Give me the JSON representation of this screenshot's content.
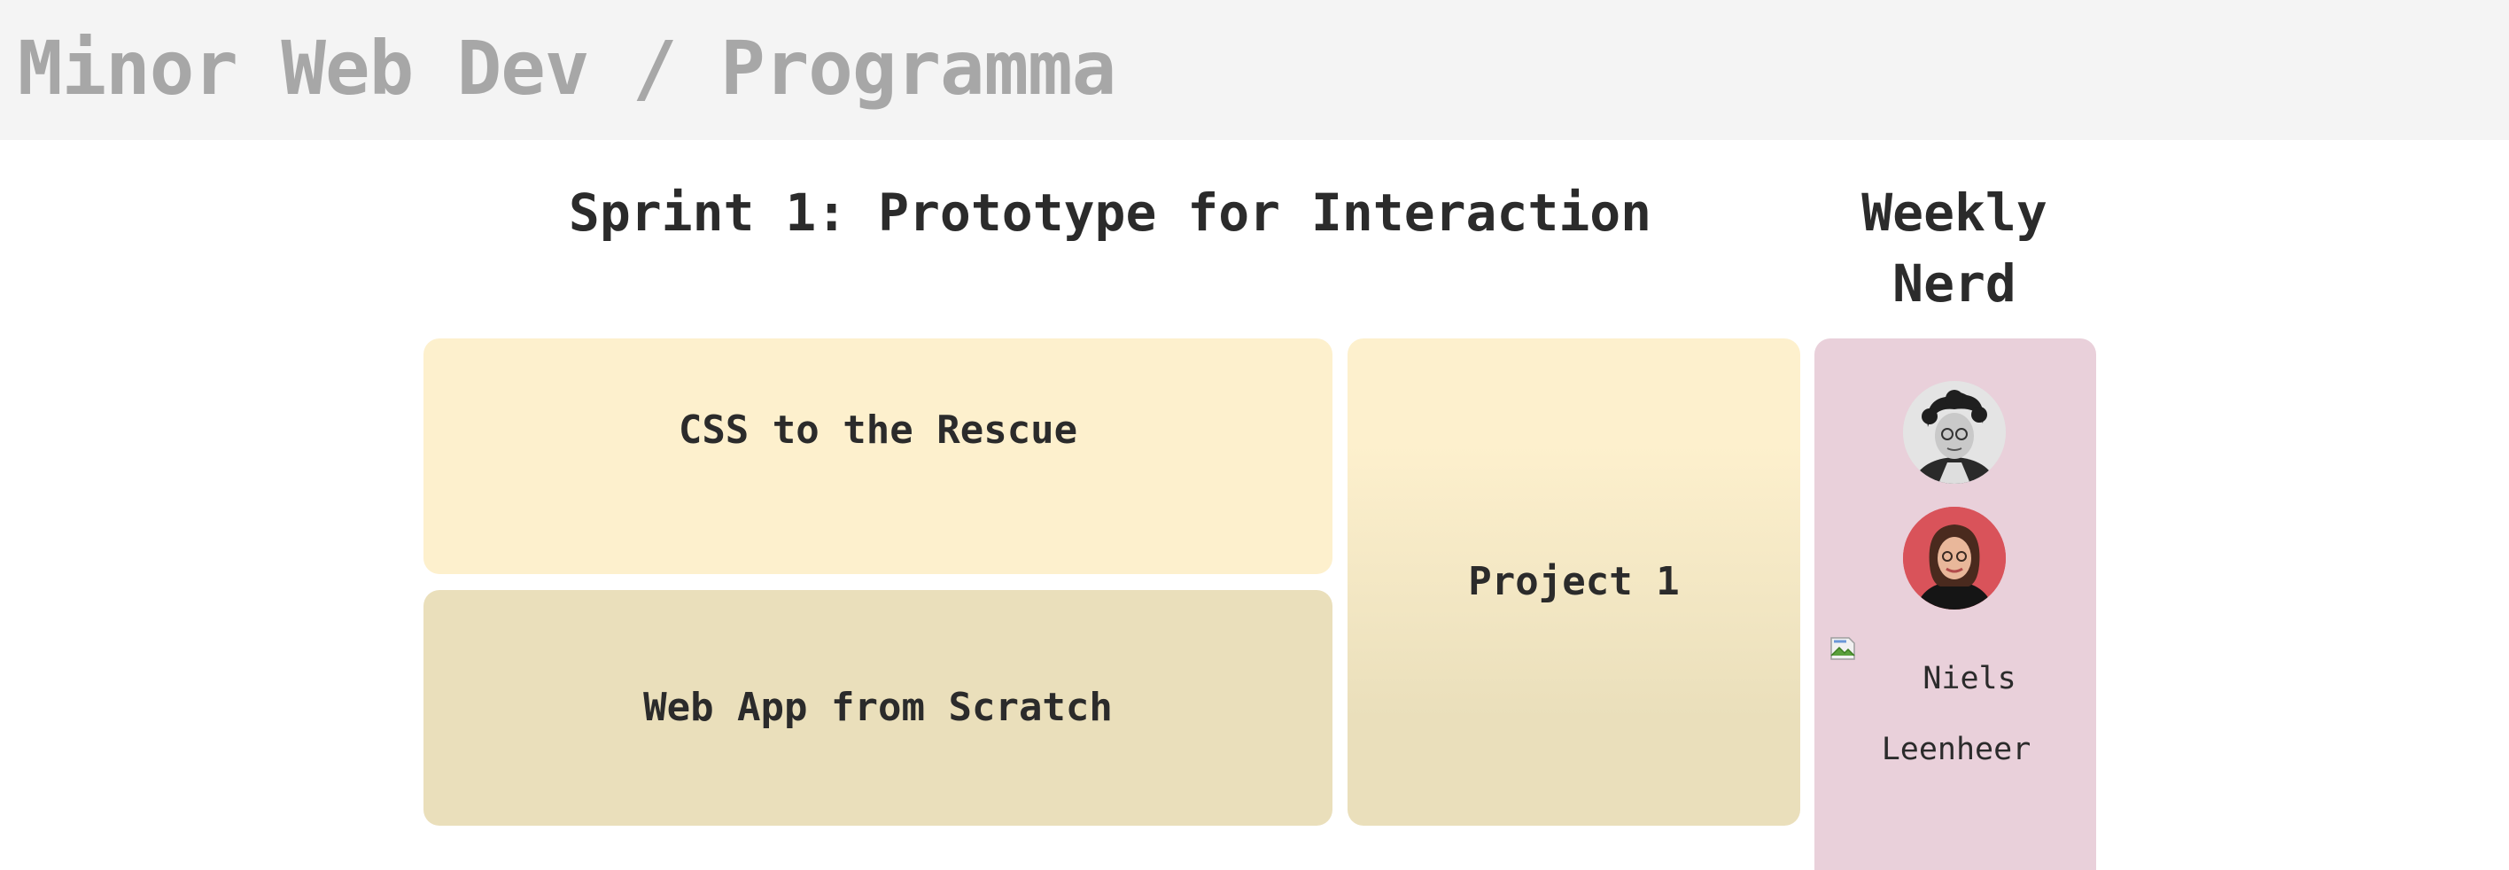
{
  "header": {
    "title": "Minor Web Dev / Programma"
  },
  "sprint": {
    "title": "Sprint 1: Prototype for Interaction",
    "courses": [
      {
        "label": "CSS to the Rescue"
      },
      {
        "label": "Web App from Scratch"
      },
      {
        "label": "Project 1"
      }
    ]
  },
  "weekly_nerd": {
    "title": "Weekly Nerd",
    "speakers": [
      {
        "avatar": "avatar-photo"
      },
      {
        "avatar": "avatar-photo"
      },
      {
        "first_name": "Niels",
        "last_name": "Leenheer",
        "image": "broken-image-icon"
      }
    ]
  },
  "colors": {
    "header_bg": "#f4f4f4",
    "header_text": "#a7a7a7",
    "card_light": "#fdf0cd",
    "card_dark": "#eadfbb",
    "weekly_bg": "#e9d0da"
  }
}
